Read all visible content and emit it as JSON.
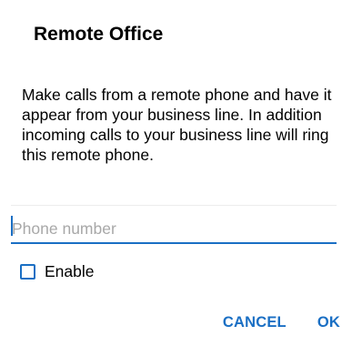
{
  "dialog": {
    "title": "Remote Office",
    "message": "Make calls from a remote phone and have it appear from your business line. In addition incoming calls to your business line will ring this remote phone.",
    "phone_input": {
      "value": "",
      "placeholder": "Phone number"
    },
    "enable": {
      "label": "Enable",
      "checked": false
    },
    "buttons": {
      "cancel": "CANCEL",
      "ok": "OK"
    },
    "colors": {
      "accent": "#1a6fc4",
      "placeholder": "#a8a8a8",
      "text": "#000000",
      "background": "#ffffff"
    }
  }
}
